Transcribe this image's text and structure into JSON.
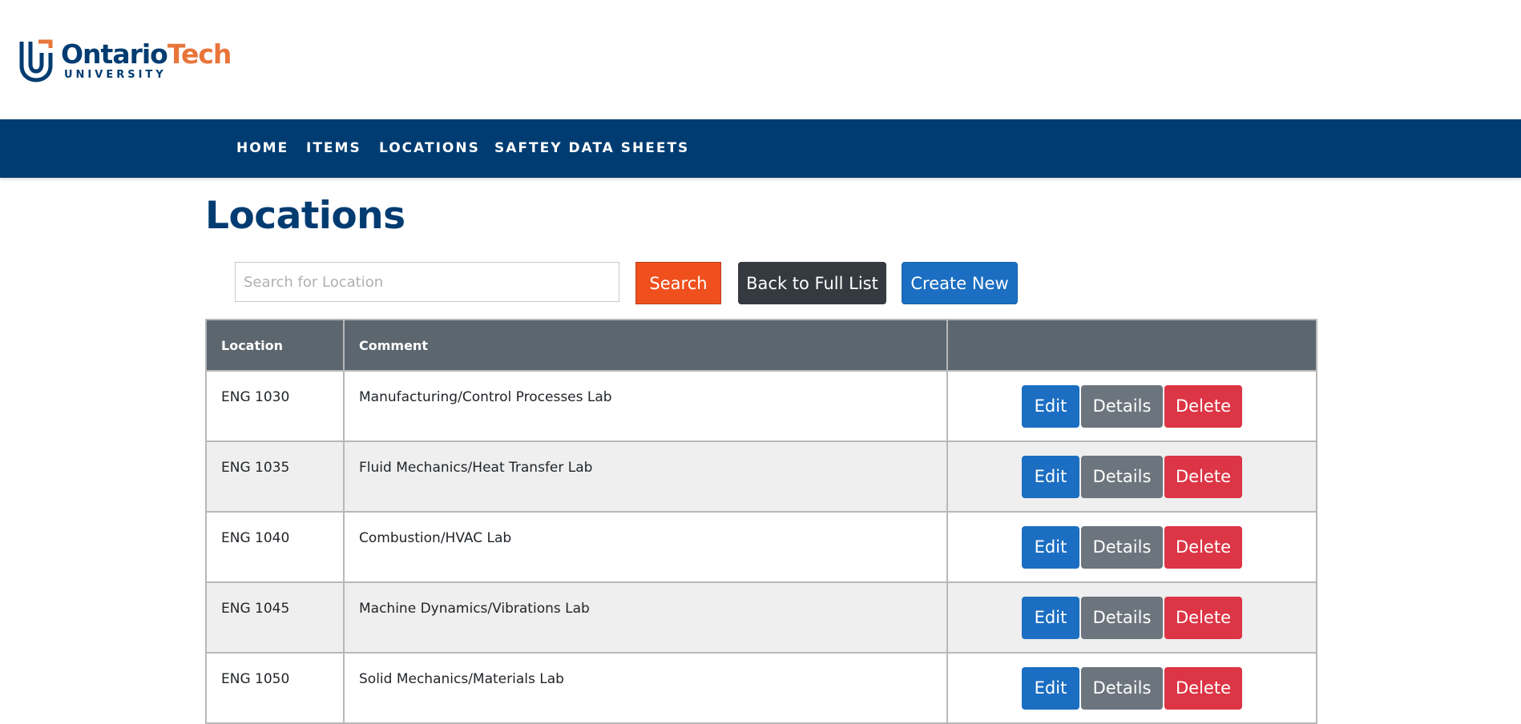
{
  "brand": {
    "name_part1": "Ontario",
    "name_part2": "Tech",
    "sub": "UNIVERSITY",
    "primary_color": "#003c71",
    "accent_color": "#e8753a"
  },
  "nav": {
    "items": [
      {
        "label": "HOME"
      },
      {
        "label": "ITEMS"
      },
      {
        "label": "LOCATIONS"
      },
      {
        "label": "SAFTEY DATA SHEETS"
      }
    ]
  },
  "page": {
    "title": "Locations"
  },
  "search": {
    "placeholder": "Search for Location",
    "value": ""
  },
  "toolbar": {
    "search_label": "Search",
    "back_label": "Back to Full List",
    "create_label": "Create New"
  },
  "table": {
    "headers": [
      "Location",
      "Comment",
      ""
    ],
    "rows": [
      {
        "location": "ENG 1030",
        "comment": "Manufacturing/Control Processes Lab"
      },
      {
        "location": "ENG 1035",
        "comment": "Fluid Mechanics/Heat Transfer Lab"
      },
      {
        "location": "ENG 1040",
        "comment": "Combustion/HVAC Lab"
      },
      {
        "location": "ENG 1045",
        "comment": "Machine Dynamics/Vibrations Lab"
      },
      {
        "location": "ENG 1050",
        "comment": "Solid Mechanics/Materials Lab"
      }
    ],
    "actions": {
      "edit": "Edit",
      "details": "Details",
      "delete": "Delete"
    }
  },
  "colors": {
    "nav_bg": "#003c71",
    "search_button": "#f0501d",
    "back_button": "#343a40",
    "primary_button": "#1b6ec2",
    "secondary_button": "#6c757d",
    "danger_button": "#dc3545",
    "table_header": "#5c666f"
  }
}
